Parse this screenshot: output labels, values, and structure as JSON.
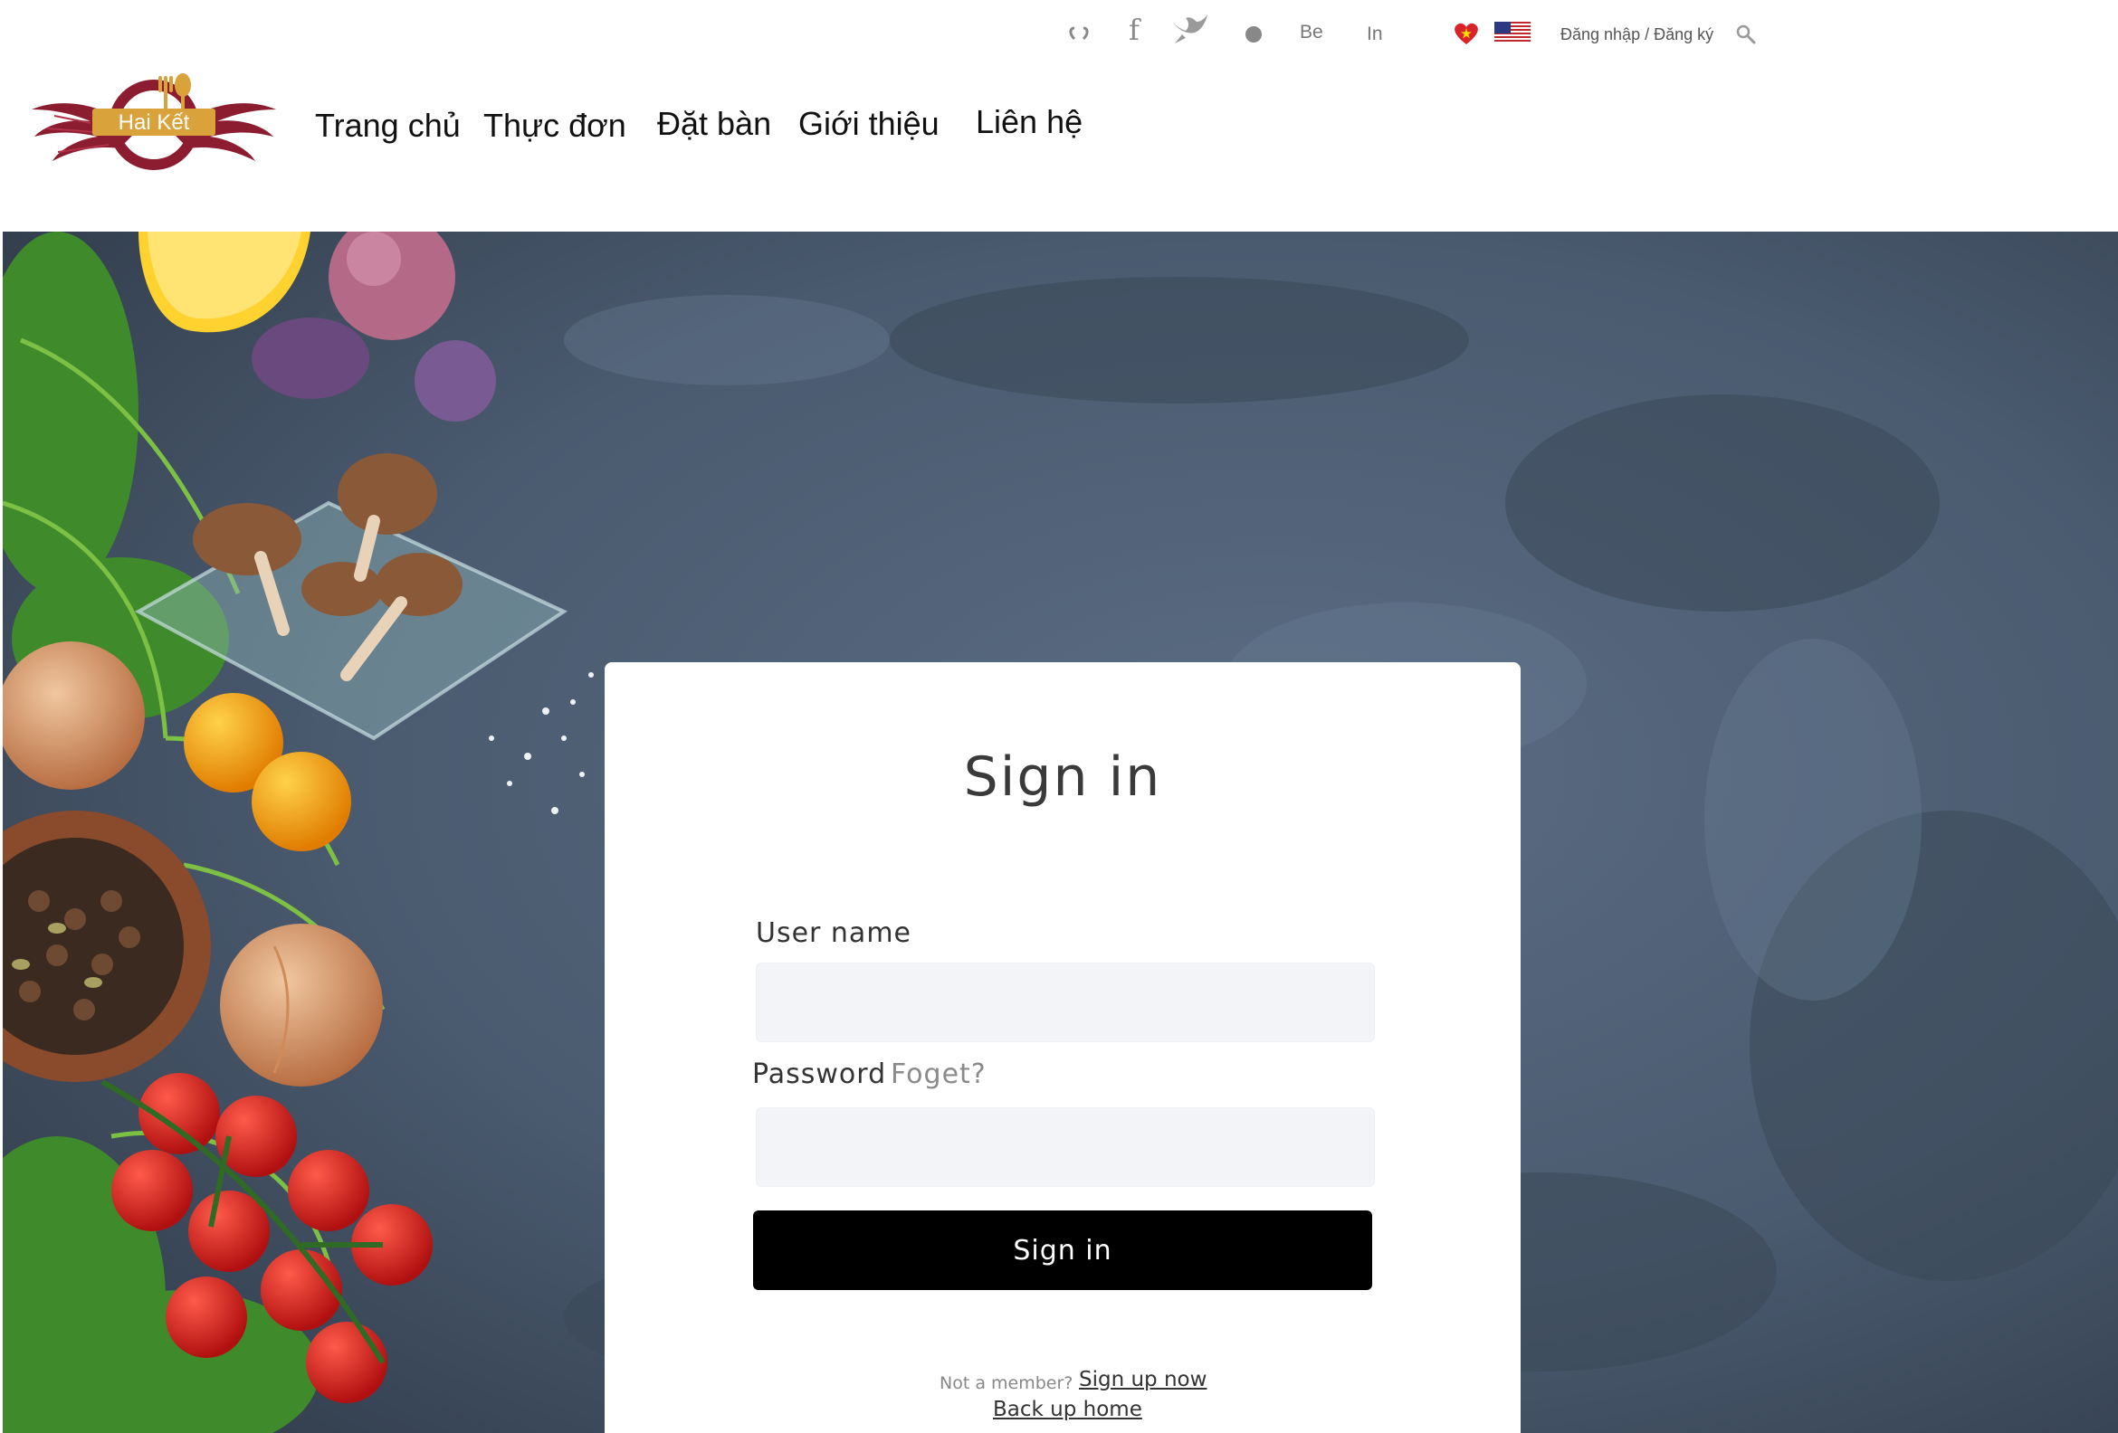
{
  "brand": {
    "logo_text": "Hai Kết"
  },
  "nav": {
    "items": [
      "Trang chủ",
      "Thực đơn",
      "Đặt bàn",
      "Giới thiệu",
      "Liên hệ"
    ]
  },
  "topbar": {
    "social": [
      {
        "icon": "flickr-icon"
      },
      {
        "icon": "facebook-icon",
        "glyph": "f"
      },
      {
        "icon": "twitter-icon"
      },
      {
        "icon": "dribbble-icon"
      },
      {
        "icon": "behance-icon",
        "glyph": "Be"
      },
      {
        "icon": "linkedin-icon",
        "glyph": "In"
      }
    ],
    "languages": [
      {
        "icon": "vietnam-flag-icon"
      },
      {
        "icon": "us-flag-icon"
      }
    ],
    "auth_link": "Đăng nhập / Đăng ký",
    "search_icon": "search-icon"
  },
  "signin": {
    "title": "Sign in",
    "username_label": "User name",
    "username_value": "",
    "password_label": "Password",
    "forgot_label": "Foget?",
    "password_value": "",
    "submit_label": "Sign in",
    "not_member": "Not a member?",
    "signup_link": "Sign up now",
    "home_link": "Back up home"
  },
  "colors": {
    "accent_burgundy": "#8c1c30",
    "logo_gold": "#d9a23a",
    "button_bg": "#000000",
    "input_bg": "#f3f4f7",
    "background_slate": "#4a5a6e"
  }
}
